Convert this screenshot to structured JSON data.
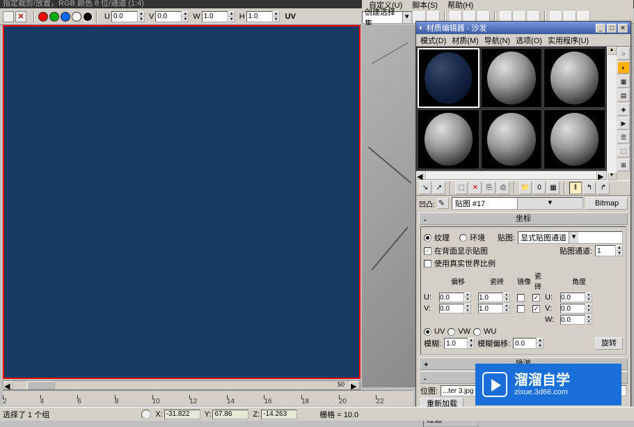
{
  "top_crop_text": "指定裁剪/放置，RGB 颜色 8 位/通道 (1:4)",
  "left_toolbar": {
    "u_label": "U",
    "u_val": "0.0",
    "v_label": "V",
    "v_val": "0.0",
    "w_label": "W",
    "w_val": "1.0",
    "h_label": "H",
    "h_val": "1.0",
    "uv_label": "UV"
  },
  "right_menu": {
    "custom": "自定义(U)",
    "script": "脚本(S)",
    "help": "帮助(H)"
  },
  "right_toolbar": {
    "create_sel": "创建选择集"
  },
  "mat_editor": {
    "title": "材质编辑器 - 沙发",
    "menu": {
      "mode": "模式(D)",
      "material": "材质(M)",
      "nav": "导航(N)",
      "options": "选项(O)",
      "util": "实用程序(U)"
    },
    "map_name": "贴图 #17",
    "type_btn": "Bitmap",
    "rollout_coords": "坐标",
    "rollout_noise": "噪波",
    "coords": {
      "texture": "纹理",
      "environ": "环境",
      "map_lbl": "贴图:",
      "map_combo": "显式贴图通道",
      "show_back": "在背面显示贴图",
      "map_channel_lbl": "贴图通道:",
      "map_channel_val": "1",
      "realworld": "使用真实世界比例",
      "offset_hdr": "偏移",
      "tile_hdr": "瓷砖",
      "mirror_hdr": "镜像",
      "tile2_hdr": "瓷砖",
      "angle_hdr": "角度",
      "u_lbl": "U:",
      "v_lbl": "V:",
      "w_lbl": "W:",
      "u_off": "0.0",
      "u_tile": "1.0",
      "u_ang": "0.0",
      "v_off": "0.0",
      "v_tile": "1.0",
      "v_ang": "0.0",
      "w_ang": "0.0",
      "uv": "UV",
      "vw": "VW",
      "wu": "WU",
      "blur_lbl": "模糊:",
      "blur_val": "1.0",
      "bluroff_lbl": "模糊偏移:",
      "bluroff_val": "0.0",
      "rotate_btn": "旋转"
    },
    "bitmap_row": {
      "label": "位图:",
      "value": "...ter 3.jpg",
      "reload": "重新加载",
      "filter": "过滤"
    }
  },
  "ruler": [
    "2",
    "4",
    "6",
    "8",
    "10",
    "12",
    "14",
    "16",
    "18",
    "20",
    "22"
  ],
  "status": {
    "selected": "选择了 1 个组",
    "x_lbl": "X:",
    "x_val": "-31.822",
    "y_lbl": "Y:",
    "y_val": "67.86",
    "z_lbl": "Z:",
    "z_val": "-14.263",
    "grid_lbl": "栅格 = 10.0"
  },
  "watermark": {
    "big": "溜溜自学",
    "small": "zixue.3d66.com"
  },
  "ruler_small": "50"
}
